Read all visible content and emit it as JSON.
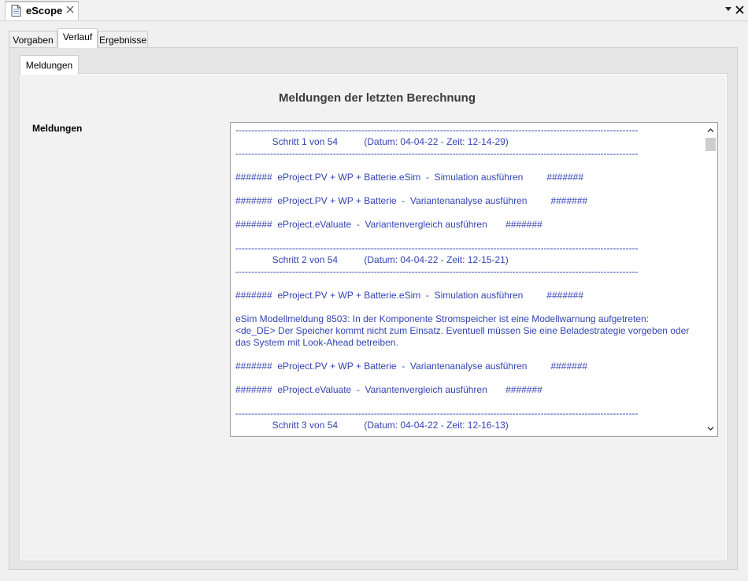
{
  "window": {
    "doc_tab_title": "eScope",
    "icons": {
      "doc": "document-icon",
      "close": "close-icon",
      "menu": "view-menu-icon",
      "window_close": "window-close-icon"
    }
  },
  "tabs": [
    "Vorgaben",
    "Verlauf",
    "Ergebnisse"
  ],
  "active_tab": "Verlauf",
  "inner_tab": "Meldungen",
  "heading": "Meldungen der letzten Berechnung",
  "section_label": "Meldungen",
  "messages": {
    "separator": "--------------------------------------------------------------------------------------------------------------------------------",
    "step1": "              Schritt 1 von 54          (Datum: 04-04-22 - Zeit: 12-14-29)",
    "s1_l1": "#######  eProject.PV + WP + Batterie.eSim  -  Simulation ausführen         #######",
    "s1_l2": "#######  eProject.PV + WP + Batterie  -  Variantenanalyse ausführen         #######",
    "s1_l3": "#######  eProject.eValuate  -  Variantenvergleich ausführen       #######",
    "step2": "              Schritt 2 von 54          (Datum: 04-04-22 - Zeit: 12-15-21)",
    "s2_l1": "#######  eProject.PV + WP + Batterie.eSim  -  Simulation ausführen         #######",
    "s2_warn1": "eSim Modellmeldung 8503: In der Komponente Stromspeicher ist eine Modellwarnung aufgetreten:",
    "s2_warn2": "<de_DE> Der Speicher kommt nicht zum Einsatz. Eventuell müssen Sie eine Beladestrategie vorgeben oder das System mit Look-Ahead betreiben.",
    "s2_l2": "#######  eProject.PV + WP + Batterie  -  Variantenanalyse ausführen         #######",
    "s2_l3": "#######  eProject.eValuate  -  Variantenvergleich ausführen       #######",
    "step3": "              Schritt 3 von 54          (Datum: 04-04-22 - Zeit: 12-16-13)"
  },
  "colors": {
    "message_text": "#3344b4",
    "panel_bg": "#f2f2f2",
    "outer_bg": "#e6e6e6"
  }
}
